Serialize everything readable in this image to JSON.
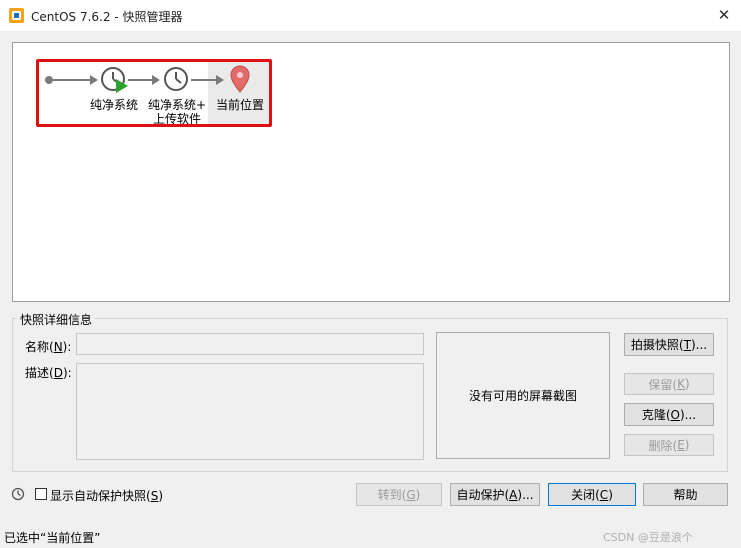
{
  "window": {
    "title": "CentOS 7.6.2 - 快照管理器",
    "close_glyph": "✕"
  },
  "tree": {
    "nodes": [
      {
        "label_line1": "纯净系统",
        "label_line2": ""
      },
      {
        "label_line1": "纯净系统+",
        "label_line2": "上传软件"
      },
      {
        "label_line1": "当前位置",
        "label_line2": ""
      }
    ]
  },
  "details": {
    "group_title": "快照详细信息",
    "name_label": "名称(",
    "name_key": "N",
    "name_label_end": "):",
    "desc_label": "描述(",
    "desc_key": "D",
    "desc_label_end": "):",
    "no_screenshot": "没有可用的屏幕截图"
  },
  "buttons": {
    "take_snapshot": {
      "pre": "拍摄快照(",
      "key": "T",
      "post": ")..."
    },
    "keep": {
      "pre": "保留(",
      "key": "K",
      "post": ")"
    },
    "clone": {
      "pre": "克隆(",
      "key": "O",
      "post": ")..."
    },
    "delete": {
      "pre": "删除(",
      "key": "E",
      "post": ")"
    },
    "goto": {
      "pre": "转到(",
      "key": "G",
      "post": ")"
    },
    "autoprotect": {
      "pre": "自动保护(",
      "key": "A",
      "post": ")..."
    },
    "close": {
      "pre": "关闭(",
      "key": "C",
      "post": ")"
    },
    "help": {
      "pre": "帮助",
      "key": "",
      "post": ""
    }
  },
  "options": {
    "show_autoprotect": {
      "pre": "显示自动保护快照(",
      "key": "S",
      "post": ")",
      "checked": false
    }
  },
  "status": {
    "text": "已选中“当前位置”",
    "watermark": "CSDN @豆是浪个"
  },
  "colors": {
    "highlight_border": "#e01010",
    "play_green": "#2ea02e",
    "pin_red": "#e46a6a"
  }
}
